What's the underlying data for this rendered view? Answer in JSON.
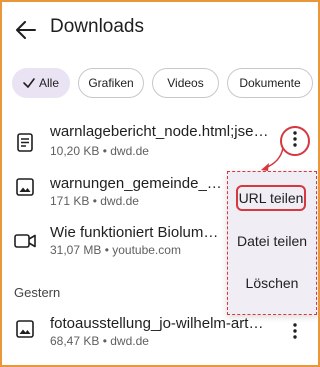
{
  "header": {
    "title": "Downloads"
  },
  "chips": {
    "all": "Alle",
    "grafiken": "Grafiken",
    "videos": "Videos",
    "dokumente": "Dokumente"
  },
  "items": [
    {
      "name": "warnlagebericht_node.html;jsessi…",
      "meta": "10,20 KB • dwd.de",
      "icon": "document-icon"
    },
    {
      "name": "warnungen_gemeinde_map",
      "meta": "171 KB • dwd.de",
      "icon": "image-icon"
    },
    {
      "name": "Wie funktioniert Biolumini…",
      "meta": "31,07 MB • youtube.com",
      "icon": "video-icon"
    },
    {
      "name": "fotoausstellung_jo-wilhelm-arts.j…",
      "meta": "68,47 KB • dwd.de",
      "icon": "image-icon"
    }
  ],
  "section": {
    "yesterday": "Gestern"
  },
  "menu": {
    "share_url": "URL teilen",
    "share_file": "Datei teilen",
    "delete": "Löschen"
  },
  "colors": {
    "accent": "#d6383f",
    "frame": "#e8973a",
    "chip_selected": "#e9e3f4",
    "menu_bg": "#f1edf4"
  }
}
